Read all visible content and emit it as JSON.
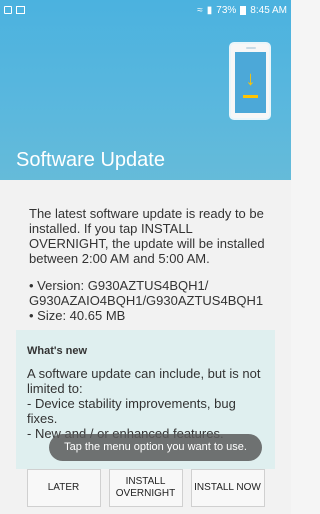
{
  "status_bar": {
    "battery": "73%",
    "time": "8:45 AM"
  },
  "header": {
    "title": "Software Update"
  },
  "main": {
    "intro": "The latest software update is ready to be installed. If you tap INSTALL OVERNIGHT, the update will be installed between 2:00 AM and 5:00 AM.",
    "version_label": "• Version: G930AZTUS4BQH1/",
    "version_cont": "G930AZAIO4BQH1/G930AZTUS4BQH1",
    "size_label": "• Size: 40.65 MB",
    "whats_new": {
      "title": "What's new",
      "line1": "A software update can include, but is not limited to:",
      "line2": " - Device stability improvements, bug fixes.",
      "line3": " - New and / or enhanced features."
    }
  },
  "toast": {
    "text": "Tap the menu option you want to use."
  },
  "buttons": {
    "later": "LATER",
    "install_overnight": "INSTALL OVERNIGHT",
    "install_now": "INSTALL NOW"
  },
  "icons": {
    "status": [
      "gallery-icon",
      "notification-icon",
      "wifi-icon",
      "signal-icon",
      "battery-icon"
    ],
    "hero": "download-phone-icon"
  }
}
